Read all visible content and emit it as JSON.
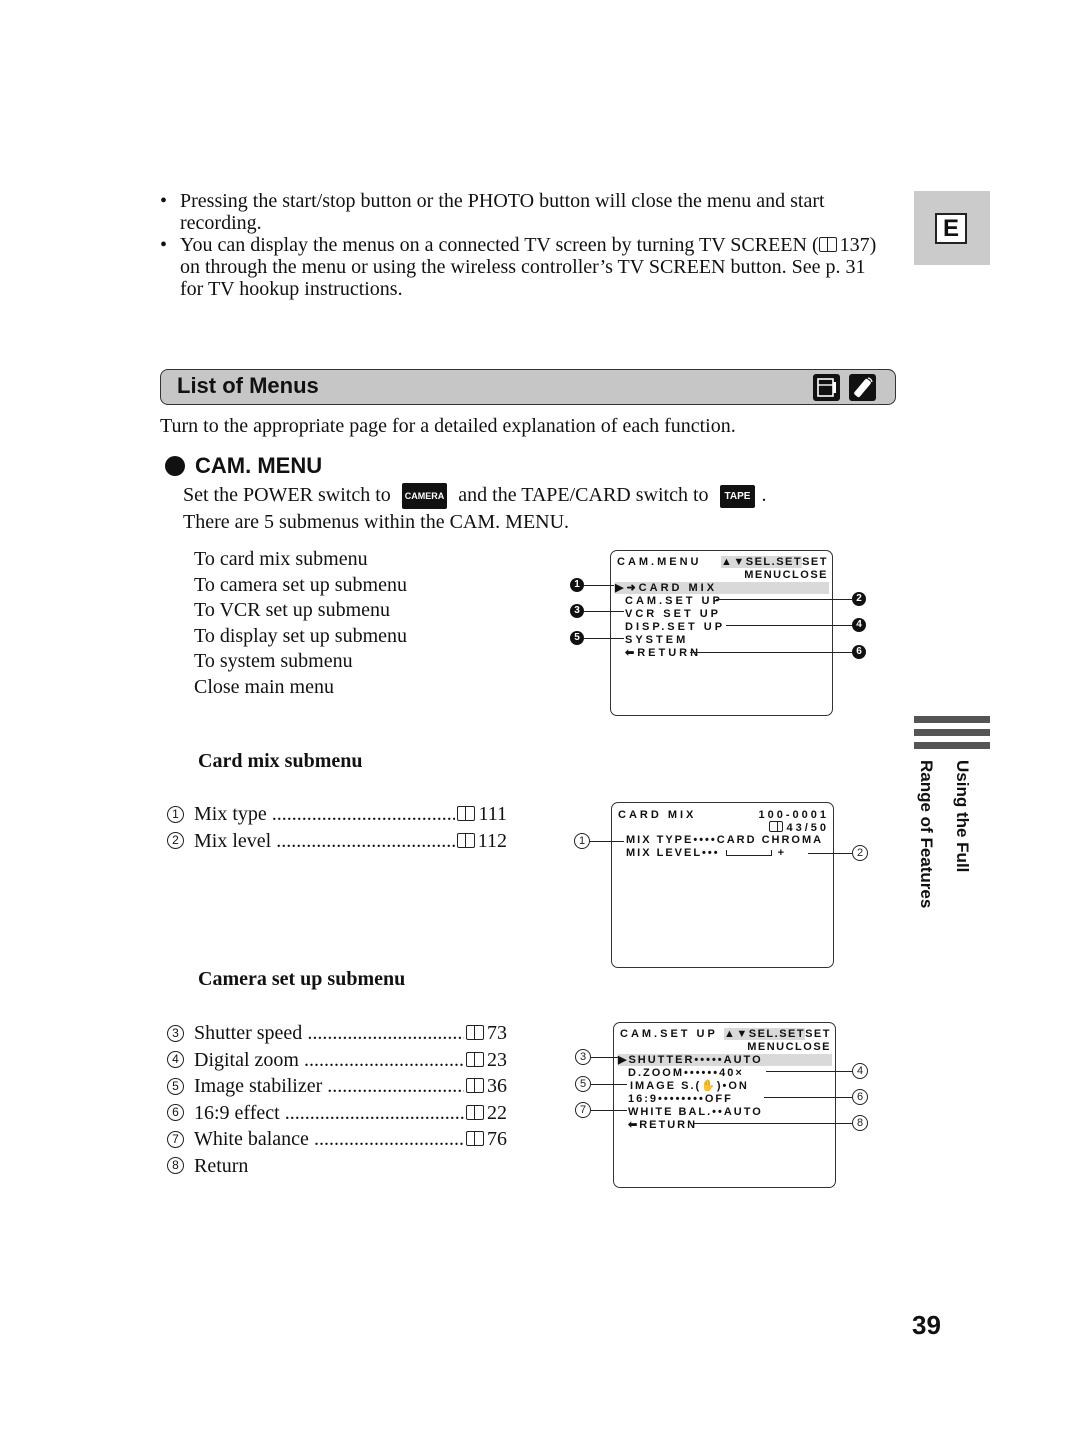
{
  "bullets": [
    "Pressing the start/stop button or the PHOTO button will close the menu and start recording.",
    {
      "before": "You can display the menus on a connected TV screen by turning TV SCREEN (",
      "ref": "137",
      "after": ") on through the menu or using the wireless controller’s TV SCREEN button. See p. 31 for TV hookup instructions."
    }
  ],
  "language_tab": "E",
  "section": {
    "title": "List of Menus",
    "icons": [
      "camcorder-icon",
      "remote-control-icon"
    ]
  },
  "intro": "Turn to the appropriate page for a detailed explanation of each function.",
  "cam_menu": {
    "heading": "CAM. MENU",
    "set_before": "Set the POWER switch to",
    "camera_key": "CAMERA",
    "set_middle": "and the TAPE/CARD switch to",
    "tape_key": "TAPE",
    "set_after": ".",
    "submenu_note": "There are 5 submenus within the CAM. MENU.",
    "items": [
      "To card mix submenu",
      "To camera set up submenu",
      "To VCR set up submenu",
      "To display set up submenu",
      "To system submenu",
      "Close main menu"
    ],
    "screen": {
      "title": "CAM.MENU",
      "sel": "▲▼SEL.",
      "set_key": "SET",
      "set": "SET",
      "menu_key": "MENU",
      "close": "CLOSE",
      "rows": [
        "▶➜CARD MIX",
        "CAM.SET UP",
        "VCR SET UP",
        "DISP.SET UP",
        "SYSTEM",
        "⬅RETURN"
      ],
      "callouts": [
        "1",
        "2",
        "3",
        "4",
        "5",
        "6"
      ]
    }
  },
  "card_mix": {
    "heading": "Card mix submenu",
    "toc": [
      {
        "num": "1",
        "label": "Mix type",
        "page": "111"
      },
      {
        "num": "2",
        "label": "Mix level",
        "page": "112"
      }
    ],
    "screen": {
      "title": "CARD MIX",
      "file_no": "100-0001",
      "count": "43/50",
      "row1_label": "MIX TYPE••••",
      "row1_value": "CARD CHROMA",
      "row2_label": "MIX LEVEL•••",
      "row2_plus": "+",
      "callouts": [
        "1",
        "2"
      ]
    }
  },
  "cam_setup": {
    "heading": "Camera set up submenu",
    "toc": [
      {
        "num": "3",
        "label": "Shutter speed",
        "page": "73"
      },
      {
        "num": "4",
        "label": "Digital zoom",
        "page": "23"
      },
      {
        "num": "5",
        "label": "Image stabilizer",
        "page": "36"
      },
      {
        "num": "6",
        "label": "16:9 effect",
        "page": "22"
      },
      {
        "num": "7",
        "label": "White balance",
        "page": "76"
      },
      {
        "num": "8",
        "label": "Return",
        "page": ""
      }
    ],
    "screen": {
      "title": "CAM.SET UP",
      "sel": "▲▼SEL.",
      "set_key": "SET",
      "set": "SET",
      "menu_key": "MENU",
      "close": "CLOSE",
      "rows": [
        "▶SHUTTER•••••AUTO",
        "D.ZOOM••••••40×",
        "IMAGE S.(✋)•ON",
        "16:9••••••••OFF",
        "WHITE BAL.••AUTO",
        "⬅RETURN"
      ],
      "callouts": [
        "3",
        "4",
        "5",
        "6",
        "7",
        "8"
      ]
    }
  },
  "side_tab": {
    "line1": "Using the Full",
    "line2": "Range of Features"
  },
  "page_number": "39"
}
